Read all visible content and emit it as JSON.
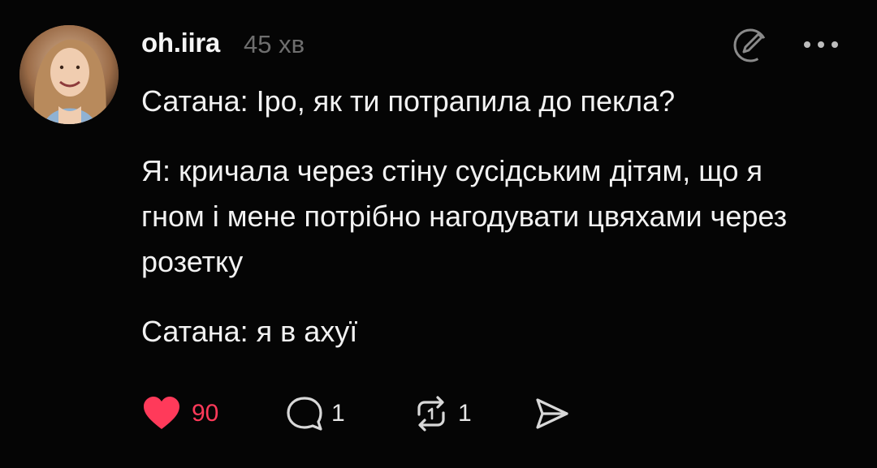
{
  "post": {
    "username": "oh.iira",
    "timestamp": "45 хв",
    "lines": [
      "Сатана: Іро, як ти потрапила до пекла?",
      "Я: кричала через стіну сусідським дітям, що я гном і мене потрібно нагодувати цвяхами через розетку",
      "Сатана: я в ахуї"
    ],
    "likes": "90",
    "comments": "1",
    "reposts": "1"
  },
  "icons": {
    "avatar": "avatar",
    "edit": "edit-pencil-icon",
    "more": "more-dots-icon",
    "like": "heart-icon",
    "comment": "comment-bubble-icon",
    "repost": "repost-icon",
    "share": "send-icon"
  },
  "colors": {
    "background": "#050505",
    "text": "#f2f2f2",
    "muted": "#6e6e6e",
    "like": "#ff3a5a"
  }
}
